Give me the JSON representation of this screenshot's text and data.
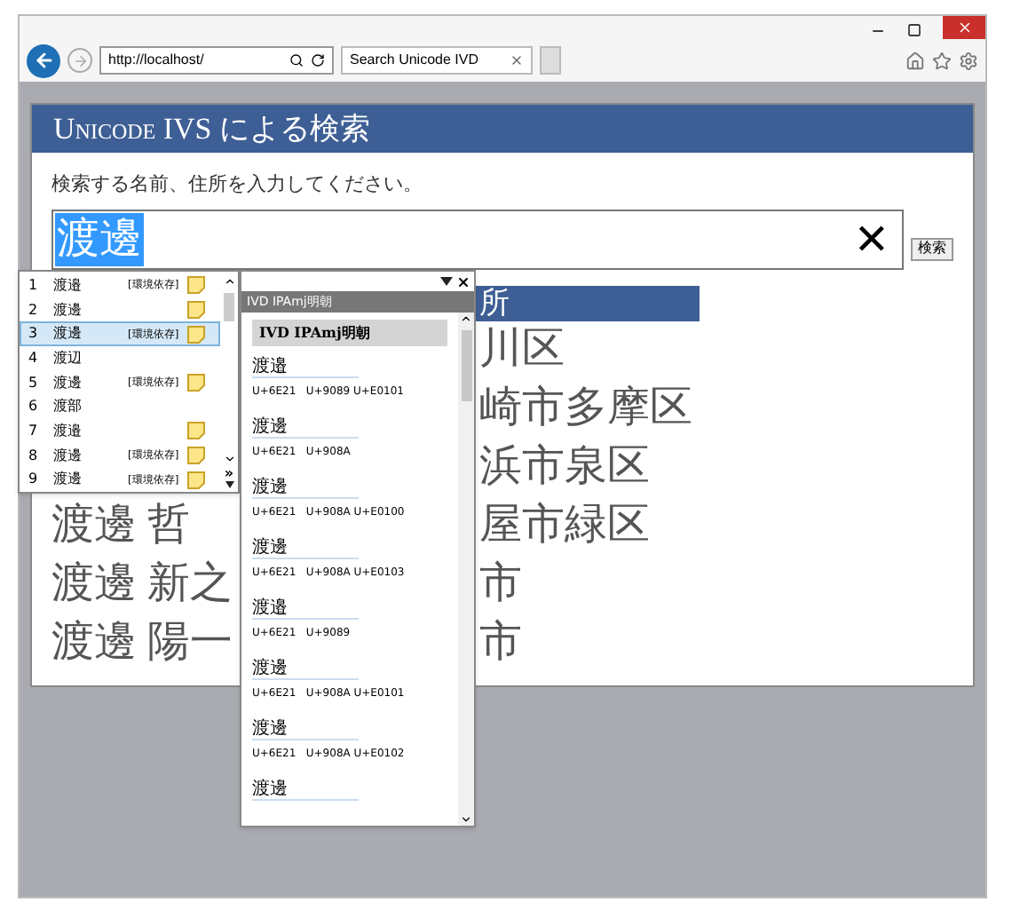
{
  "browser": {
    "address": "http://localhost/",
    "tab_title": "Search Unicode IVD"
  },
  "page": {
    "title": "Unicode IVS による検索",
    "instruction": "検索する名前、住所を入力してください。",
    "search_value": "渡邊",
    "clear_symbol": "✕",
    "search_button": "検索"
  },
  "table": {
    "header_address": "所",
    "rows": [
      {
        "address": "川区"
      },
      {
        "address": "崎市多摩区"
      },
      {
        "address": "浜市泉区"
      },
      {
        "name": "渡邊 哲",
        "address": "屋市緑区"
      },
      {
        "name": "渡邊 新之",
        "address": "市"
      },
      {
        "name": "渡邊 陽一",
        "address": "市"
      }
    ]
  },
  "candidates": {
    "more": "»",
    "items": [
      {
        "number": "1",
        "text": "渡邉",
        "tag": "[環境依存]",
        "note": true,
        "selected": false
      },
      {
        "number": "2",
        "text": "渡邊",
        "note": true,
        "selected": false
      },
      {
        "number": "3",
        "text": "渡邊",
        "tag": "[環境依存]",
        "note": true,
        "selected": true
      },
      {
        "number": "4",
        "text": "渡辺",
        "note": false,
        "selected": false
      },
      {
        "number": "5",
        "text": "渡邊",
        "tag": "[環境依存]",
        "note": true,
        "selected": false
      },
      {
        "number": "6",
        "text": "渡部",
        "note": false,
        "selected": false
      },
      {
        "number": "7",
        "text": "渡邉",
        "note": true,
        "selected": false
      },
      {
        "number": "8",
        "text": "渡邊",
        "tag": "[環境依存]",
        "note": true,
        "selected": false
      },
      {
        "number": "9",
        "text": "渡邊",
        "tag": "[環境依存]",
        "note": true,
        "selected": false
      }
    ]
  },
  "ivd_panel": {
    "caption": "IVD IPAmj明朝",
    "heading": "IVD IPAmj明朝",
    "entries": [
      {
        "glyph": "渡邉",
        "codes": "U+6E21   U+9089 U+E0101"
      },
      {
        "glyph": "渡邊",
        "codes": "U+6E21   U+908A"
      },
      {
        "glyph": "渡邊",
        "codes": "U+6E21   U+908A U+E0100"
      },
      {
        "glyph": "渡邊",
        "codes": "U+6E21   U+908A U+E0103"
      },
      {
        "glyph": "渡邉",
        "codes": "U+6E21   U+9089"
      },
      {
        "glyph": "渡邊",
        "codes": "U+6E21   U+908A U+E0101"
      },
      {
        "glyph": "渡邊",
        "codes": "U+6E21   U+908A U+E0102"
      },
      {
        "glyph": "渡邊"
      }
    ]
  }
}
